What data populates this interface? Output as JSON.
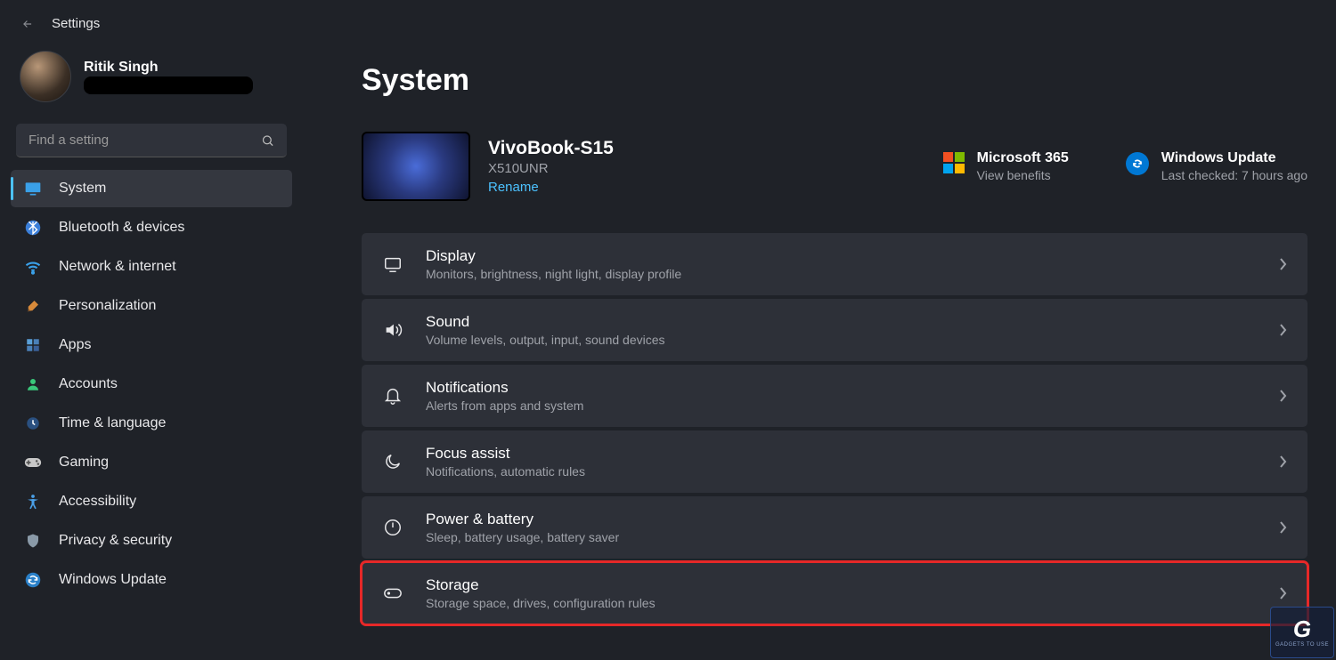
{
  "header": {
    "title": "Settings"
  },
  "user": {
    "name": "Ritik Singh"
  },
  "search": {
    "placeholder": "Find a setting"
  },
  "sidebar": {
    "items": [
      {
        "label": "System"
      },
      {
        "label": "Bluetooth & devices"
      },
      {
        "label": "Network & internet"
      },
      {
        "label": "Personalization"
      },
      {
        "label": "Apps"
      },
      {
        "label": "Accounts"
      },
      {
        "label": "Time & language"
      },
      {
        "label": "Gaming"
      },
      {
        "label": "Accessibility"
      },
      {
        "label": "Privacy & security"
      },
      {
        "label": "Windows Update"
      }
    ]
  },
  "page": {
    "title": "System"
  },
  "device": {
    "name": "VivoBook-S15",
    "model": "X510UNR",
    "rename": "Rename"
  },
  "promos": {
    "m365": {
      "title": "Microsoft 365",
      "sub": "View benefits"
    },
    "wu": {
      "title": "Windows Update",
      "sub": "Last checked: 7 hours ago"
    }
  },
  "cards": [
    {
      "title": "Display",
      "desc": "Monitors, brightness, night light, display profile"
    },
    {
      "title": "Sound",
      "desc": "Volume levels, output, input, sound devices"
    },
    {
      "title": "Notifications",
      "desc": "Alerts from apps and system"
    },
    {
      "title": "Focus assist",
      "desc": "Notifications, automatic rules"
    },
    {
      "title": "Power & battery",
      "desc": "Sleep, battery usage, battery saver"
    },
    {
      "title": "Storage",
      "desc": "Storage space, drives, configuration rules"
    }
  ],
  "watermark": {
    "logo": "G",
    "text": "GADGETS TO USE"
  }
}
